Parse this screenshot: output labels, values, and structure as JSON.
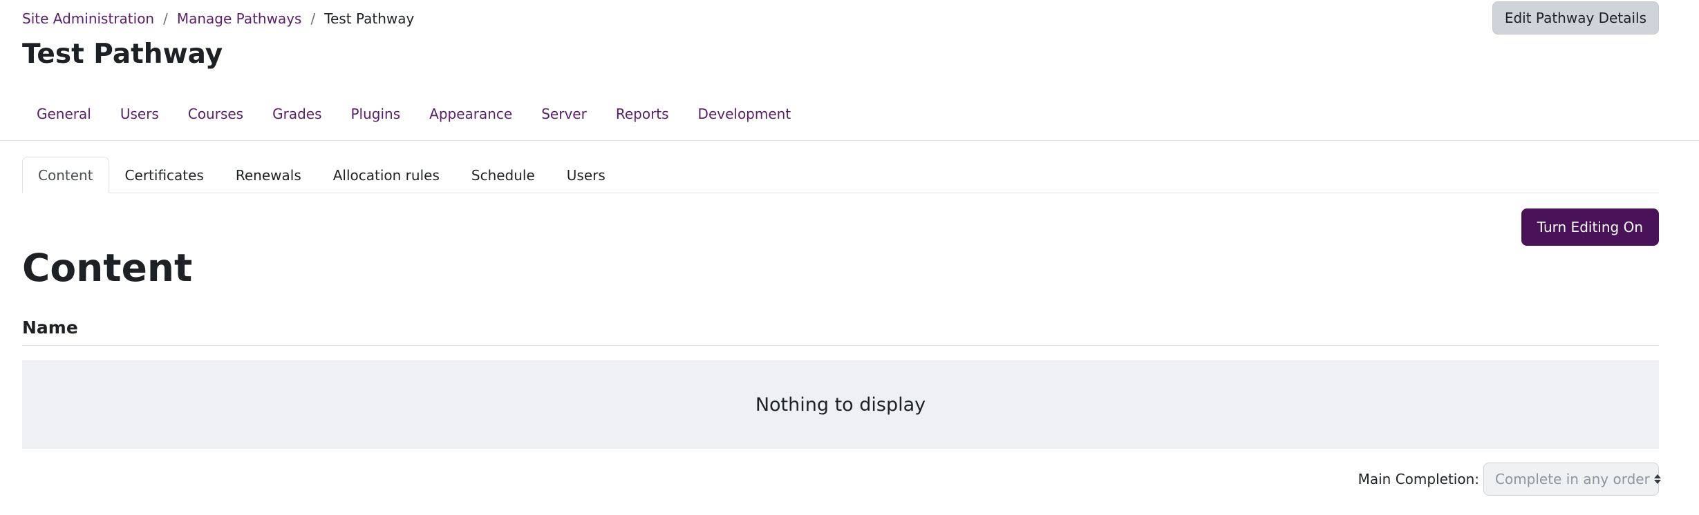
{
  "breadcrumb": {
    "items": [
      "Site Administration",
      "Manage Pathways"
    ],
    "separator": "/",
    "current": "Test Pathway"
  },
  "page_title": "Test Pathway",
  "header": {
    "edit_button_label": "Edit Pathway Details"
  },
  "primary_nav": {
    "items": [
      {
        "label": "General"
      },
      {
        "label": "Users"
      },
      {
        "label": "Courses"
      },
      {
        "label": "Grades"
      },
      {
        "label": "Plugins"
      },
      {
        "label": "Appearance"
      },
      {
        "label": "Server"
      },
      {
        "label": "Reports"
      },
      {
        "label": "Development"
      }
    ]
  },
  "tabs": {
    "active": "Content",
    "items": [
      {
        "label": "Content"
      },
      {
        "label": "Certificates"
      },
      {
        "label": "Renewals"
      },
      {
        "label": "Allocation rules"
      },
      {
        "label": "Schedule"
      },
      {
        "label": "Users"
      }
    ]
  },
  "actions": {
    "turn_editing_label": "Turn Editing On"
  },
  "content": {
    "title": "Content",
    "table": {
      "column_header": "Name",
      "empty_message": "Nothing to display"
    }
  },
  "completion": {
    "label": "Main Completion:",
    "selected": "Complete in any order",
    "icon": "select-updown-arrows-icon"
  },
  "colors": {
    "link": "#5a1e6c",
    "primary_button": "#4a1359",
    "secondary_button": "#ced4da",
    "empty_row_bg": "#eff0f3",
    "border": "#dee2e6",
    "text": "#1d2125"
  }
}
